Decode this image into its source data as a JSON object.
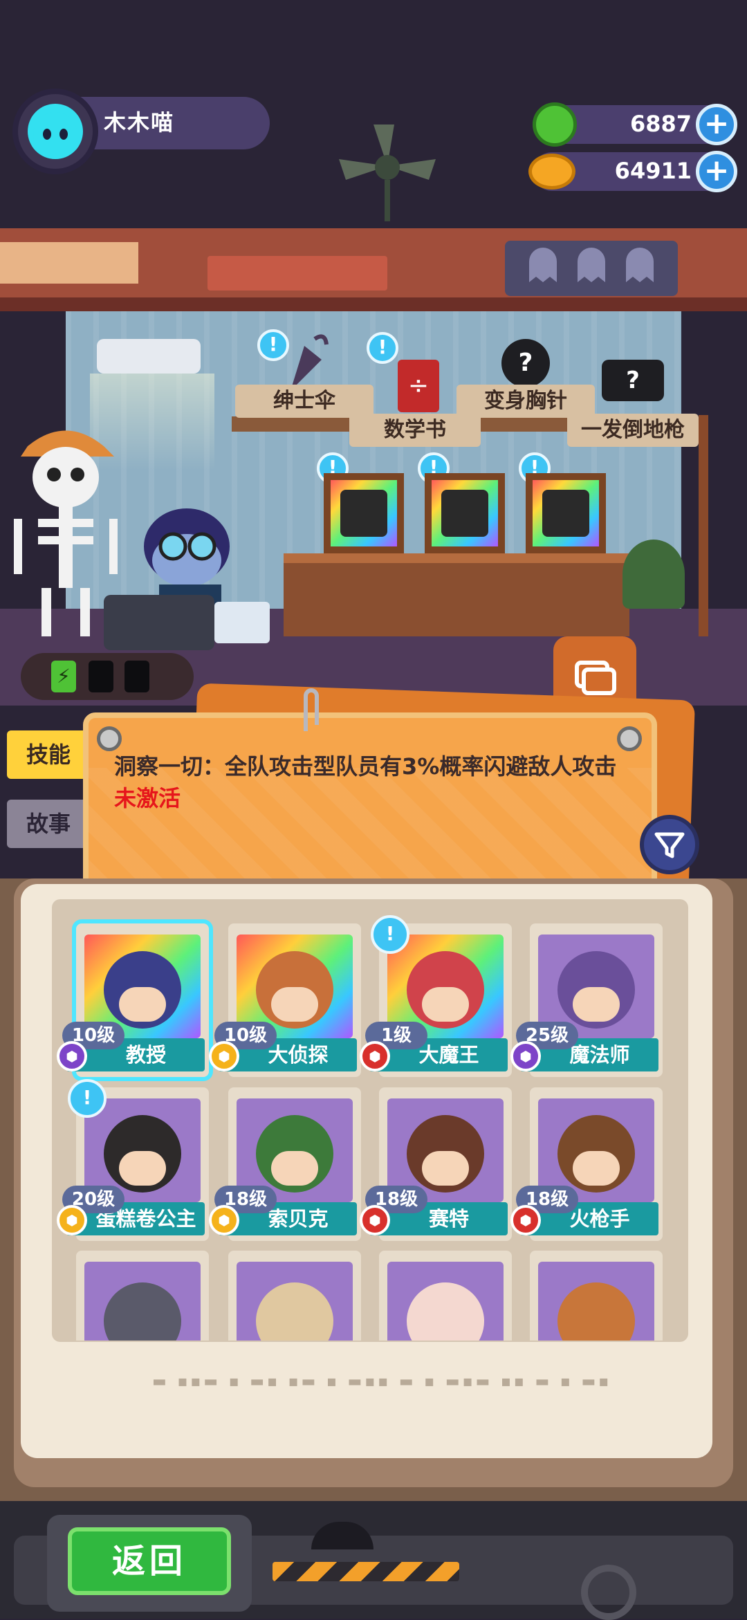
{
  "player": {
    "name": "木木喵"
  },
  "currencies": [
    {
      "icon": "gem-icon",
      "value": "6887"
    },
    {
      "icon": "coin-icon",
      "value": "64911"
    }
  ],
  "shelf_items": [
    {
      "label": "绅士伞"
    },
    {
      "label": "数学书"
    },
    {
      "label": "变身胸针"
    },
    {
      "label": "一发倒地枪"
    }
  ],
  "side_tabs": {
    "skills": "技能",
    "story": "故事"
  },
  "skill": {
    "description": "洞察一切：全队攻击型队员有3%概率闪避敌人攻击",
    "status": "未激活"
  },
  "characters": [
    {
      "name": "教授",
      "level": "10级",
      "badge": "purple",
      "rainbow": true,
      "bubble": false,
      "selected": true,
      "head": "#3a3f8a"
    },
    {
      "name": "大侦探",
      "level": "10级",
      "badge": "gold",
      "rainbow": true,
      "bubble": false,
      "selected": false,
      "head": "#c8703a"
    },
    {
      "name": "大魔王",
      "level": "1级",
      "badge": "red",
      "rainbow": true,
      "bubble": true,
      "selected": false,
      "head": "#d0434b"
    },
    {
      "name": "魔法师",
      "level": "25级",
      "badge": "purple",
      "rainbow": false,
      "bubble": false,
      "selected": false,
      "head": "#6a4f9a"
    },
    {
      "name": "蛋糕卷公主",
      "level": "20级",
      "badge": "gold",
      "rainbow": false,
      "bubble": true,
      "selected": false,
      "head": "#2d2a2a"
    },
    {
      "name": "索贝克",
      "level": "18级",
      "badge": "gold",
      "rainbow": false,
      "bubble": false,
      "selected": false,
      "head": "#3d7a3a"
    },
    {
      "name": "赛特",
      "level": "18级",
      "badge": "red",
      "rainbow": false,
      "bubble": false,
      "selected": false,
      "head": "#6a3a2a"
    },
    {
      "name": "火枪手",
      "level": "18级",
      "badge": "red",
      "rainbow": false,
      "bubble": false,
      "selected": false,
      "head": "#7a4a2a"
    }
  ],
  "partial_row_heads": [
    "#5a5a6a",
    "#e0c8a0",
    "#f4d8d0",
    "#c8763a"
  ],
  "bottom": {
    "back_label": "返回"
  },
  "colors": {
    "accent": "#1a9aa0",
    "back_green": "#30b83f",
    "status_red": "#e6161b"
  }
}
